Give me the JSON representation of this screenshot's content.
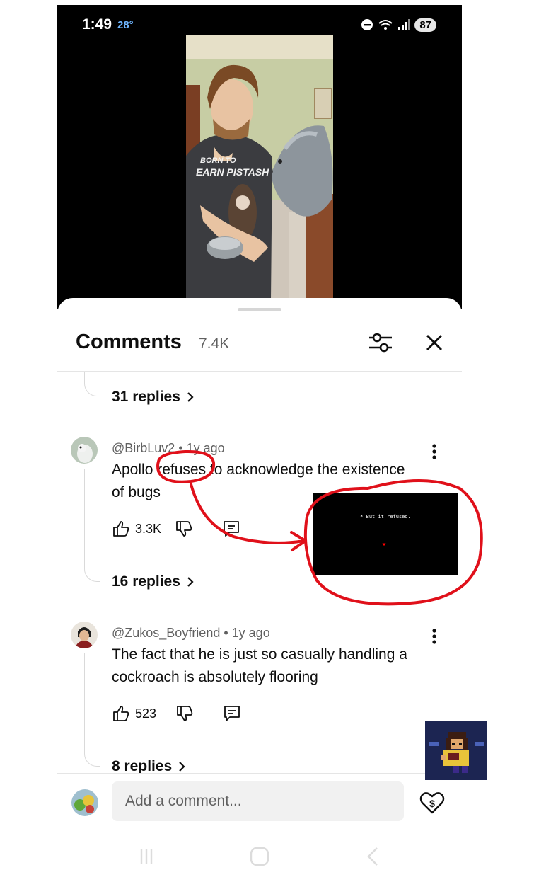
{
  "status_bar": {
    "time": "1:49",
    "temperature": "28°",
    "battery": "87"
  },
  "video": {
    "shirt_text_line1": "BORN TO",
    "shirt_text_line2": "EARN PISTASH"
  },
  "comments_sheet": {
    "title": "Comments",
    "count": "7.4K",
    "first_thread_replies": "31 replies",
    "comments": [
      {
        "author": "@BirbLuv2",
        "age": "1y ago",
        "text_line1": "Apollo refuses to acknowledge the existence",
        "text_line2": "of bugs",
        "likes": "3.3K",
        "replies": "16 replies"
      },
      {
        "author": "@Zukos_Boyfriend",
        "age": "1y ago",
        "text_line1": "The fact that he is just so casually handling a",
        "text_line2": "cockroach is absolutely flooring",
        "likes": "523",
        "replies": "8 replies"
      }
    ]
  },
  "composer": {
    "placeholder": "Add a comment..."
  },
  "inset_image": {
    "text": "* But it refused."
  },
  "colors": {
    "annotation_red": "#e0101a",
    "accent_grey": "#606060"
  }
}
